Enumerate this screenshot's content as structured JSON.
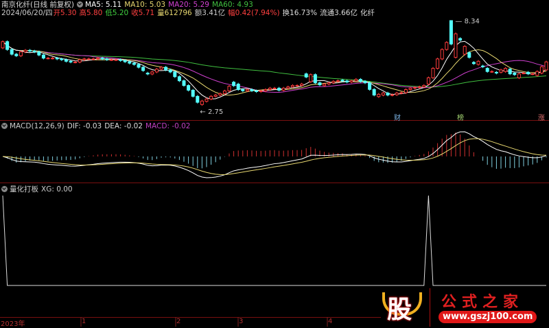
{
  "header": {
    "title": "南京化纤(日线 前复权)",
    "ma5": "MA5: 5.11",
    "ma10": "MA10: 5.03",
    "ma20": "MA20: 5.29",
    "ma60": "MA60: 4.93",
    "date": "2024/06/20/四",
    "open": "开5.30",
    "high": "高5.80",
    "low": "低5.20",
    "close": "收5.71",
    "volume": "量612796",
    "amount": "额3.41亿",
    "change": "幅0.42(7.94%)",
    "turnover": "换16.73%",
    "float": "流通3.66亿",
    "sector": "化纤"
  },
  "macd_header": {
    "name": "MACD(12,26,9)",
    "dif": "DIF: -0.03",
    "dea": "DEA: -0.02",
    "macd": "MACD: -0.02"
  },
  "xg_header": {
    "name": "量化打板",
    "xg": "XG: 0.00"
  },
  "markers": {
    "high_label": "8.34",
    "low_label": "2.75",
    "tag_cai": "财",
    "tag_bang": "榜",
    "tag_zhang": "涨"
  },
  "time_axis": [
    "2023年",
    "1",
    "2",
    "3",
    "4"
  ],
  "logo": {
    "char": "股",
    "name": "公式之家",
    "url": "www.gszj100.com"
  },
  "colors": {
    "up": "#ff3c3c",
    "down": "#54ffff",
    "ma5": "#ffffff",
    "ma10": "#e8d870",
    "ma20": "#d040d0",
    "ma60": "#40c040"
  },
  "chart_data": {
    "type": "candlestick",
    "title": "南京化纤(日线 前复权)",
    "ylim": [
      2.75,
      8.34
    ],
    "open": [
      6.6,
      7.0,
      6.5,
      6.2,
      6.1,
      6.35,
      6.45,
      6.4,
      6.35,
      6.15,
      5.95,
      5.95,
      5.95,
      5.9,
      5.85,
      5.75,
      5.7,
      5.7,
      5.85,
      5.9,
      5.9,
      5.9,
      5.95,
      5.9,
      5.85,
      5.85,
      5.85,
      5.8,
      5.72,
      5.63,
      5.55,
      5.37,
      5.0,
      4.94,
      5.07,
      5.25,
      5.37,
      5.2,
      5.07,
      4.77,
      4.51,
      4.21,
      3.91,
      3.52,
      3.0,
      3.2,
      3.35,
      3.52,
      3.6,
      3.69,
      3.86,
      4.42,
      4.3,
      3.95,
      3.87,
      3.95,
      3.87,
      3.82,
      3.87,
      3.95,
      4.04,
      4.04,
      3.91,
      4.04,
      4.12,
      4.21,
      4.21,
      4.95,
      4.45,
      4.9,
      4.38,
      4.2,
      4.3,
      4.38,
      4.47,
      4.55,
      4.5,
      4.43,
      4.51,
      4.6,
      4.47,
      4.38,
      3.96,
      3.5,
      3.6,
      3.73,
      3.6,
      3.62,
      3.73,
      3.75,
      3.95,
      4.04,
      4.08,
      4.12,
      4.3,
      4.7,
      5.3,
      5.9,
      6.5,
      8.34,
      6.0,
      7.2,
      6.2,
      6.3,
      5.68,
      5.55,
      5.45,
      5.3,
      5.1,
      5.05,
      5.05,
      5.1,
      5.25,
      5.0,
      4.7,
      5.0,
      5.05,
      4.95,
      4.85,
      5.0,
      5.2
    ],
    "close": [
      7.0,
      6.5,
      6.2,
      6.1,
      6.35,
      6.45,
      6.4,
      6.35,
      6.15,
      5.95,
      5.95,
      5.95,
      5.9,
      5.85,
      5.75,
      5.7,
      5.7,
      5.85,
      5.9,
      5.9,
      5.9,
      5.95,
      5.9,
      5.85,
      5.85,
      5.85,
      5.8,
      5.72,
      5.63,
      5.55,
      5.37,
      5.16,
      4.94,
      5.07,
      5.25,
      5.37,
      5.2,
      5.07,
      4.77,
      4.51,
      4.21,
      3.91,
      3.52,
      3.14,
      3.22,
      3.35,
      3.52,
      3.6,
      3.69,
      3.86,
      4.16,
      4.2,
      3.95,
      3.87,
      3.95,
      3.87,
      3.82,
      3.87,
      3.95,
      4.04,
      4.04,
      3.91,
      4.04,
      4.12,
      4.21,
      4.21,
      4.3,
      4.75,
      4.9,
      4.38,
      4.25,
      4.3,
      4.38,
      4.47,
      4.51,
      4.5,
      4.43,
      4.51,
      4.6,
      4.47,
      4.38,
      3.96,
      3.6,
      3.65,
      3.73,
      3.6,
      3.62,
      3.73,
      3.75,
      3.95,
      4.04,
      4.08,
      4.12,
      4.21,
      4.7,
      5.3,
      5.9,
      6.5,
      6.95,
      6.85,
      7.5,
      7.1,
      6.7,
      6.0,
      5.6,
      5.75,
      5.4,
      5.1,
      5.1,
      5.0,
      5.2,
      5.3,
      4.95,
      4.9,
      4.95,
      5.0,
      4.95,
      4.95,
      5.1,
      5.4,
      5.71
    ],
    "xg_signal_index": [
      0,
      94
    ]
  }
}
